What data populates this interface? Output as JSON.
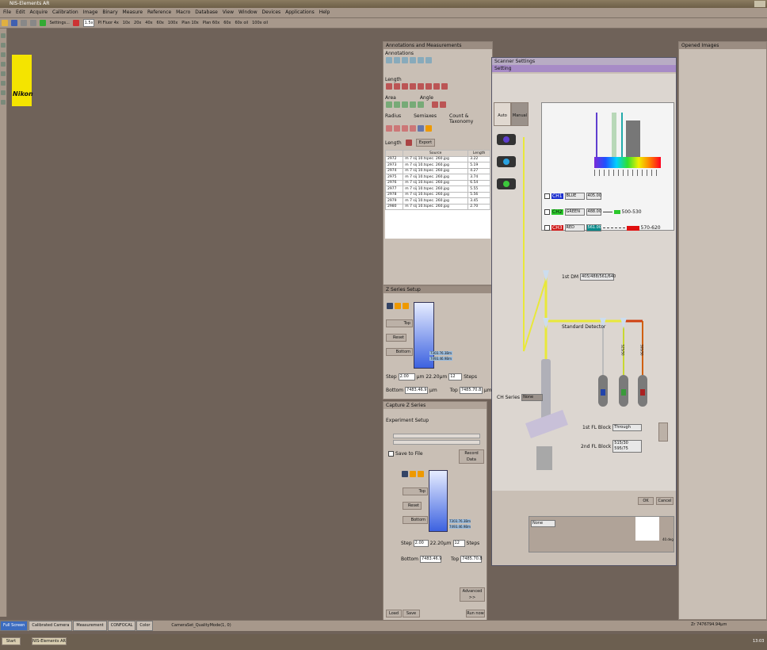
{
  "app": {
    "title": "NIS-Elements AR"
  },
  "menu": [
    "File",
    "Edit",
    "Acquire",
    "Calibration",
    "Image",
    "Binary",
    "Measure",
    "Reference",
    "Macro",
    "Database",
    "View",
    "Window",
    "Devices",
    "Applications",
    "Help"
  ],
  "toolbar": {
    "settings": "Settings...",
    "zoom": "1.5x",
    "objectives": [
      "Pl Fluor 4x",
      "10x",
      "20x",
      "40x",
      "60x",
      "100x",
      "Plan 10x",
      "Plan 60x",
      "60x",
      "60x oil",
      "100x oil"
    ]
  },
  "annotations_panel": {
    "title": "Annotations and Measurements",
    "annotations_label": "Annotations",
    "length_label": "Length",
    "area_label": "Area",
    "angle_label": "Angle",
    "radius_label": "Radius",
    "semiaxes_label": "Semiaxes",
    "count_label": "Count & Taxonomy",
    "list_mode": "Length",
    "export_label": "Export",
    "table_headers": [
      "Source",
      "Length"
    ],
    "rows": [
      {
        "id": "2972",
        "source": "m 7 sij 10.tspec. 260.jpg",
        "value": "3.22"
      },
      {
        "id": "2973",
        "source": "m 7 sij 10.tspec. 260.jpg",
        "value": "5.19"
      },
      {
        "id": "2974",
        "source": "m 7 sij 10.tspec. 260.jpg",
        "value": "4.27"
      },
      {
        "id": "2975",
        "source": "m 7 sij 10.tspec. 260.jpg",
        "value": "3.74"
      },
      {
        "id": "2976",
        "source": "m 7 sij 10.tspec. 260.jpg",
        "value": "6.54"
      },
      {
        "id": "2977",
        "source": "m 7 sij 10.tspec. 260.jpg",
        "value": "5.55"
      },
      {
        "id": "2978",
        "source": "m 7 sij 10.tspec. 260.jpg",
        "value": "5.56"
      },
      {
        "id": "2979",
        "source": "m 7 sij 10.tspec. 260.jpg",
        "value": "3.45"
      },
      {
        "id": "2980",
        "source": "m 7 sij 10.tspec. 260.jpg",
        "value": "2.70"
      }
    ]
  },
  "zseries": {
    "title": "Z Series Setup",
    "top": "Top",
    "reset": "Reset",
    "bottom": "Bottom",
    "range1": "7303.76.3Bm",
    "range2": "7493.46.9Bm",
    "step_label": "Step",
    "step_value": "2.00",
    "range_value": "22.20µm",
    "steps_value": "12",
    "steps_unit": "Steps",
    "bottom_label": "Bottom",
    "bottom_value": "7483.46.9",
    "top_label": "Top",
    "top_value": "7485.70.8",
    "unit": "µm"
  },
  "capture": {
    "title": "Capture Z Series",
    "experiment_setup": "Experiment Setup",
    "save_to_file": "Save to File",
    "record_data": "Record Data",
    "step_value": "2.00",
    "range_value": "22.20µm",
    "steps_value": "12",
    "bottom_value": "7483.46.9",
    "top_value": "7485.70.8",
    "advanced": "Advanced >>",
    "load": "Load",
    "save": "Save",
    "run": "Run now"
  },
  "scanner_dialog": {
    "title": "Scanner Settings",
    "setting_title": "Setting",
    "mode_auto": "Auto",
    "mode_manual": "Manual",
    "channels": [
      {
        "ch": "CH1",
        "name": "BLUE",
        "wl": "405.00",
        "color": "#1b2fcf"
      },
      {
        "ch": "CH2",
        "name": "GREEN",
        "wl": "488.00",
        "color": "#2bc82b"
      },
      {
        "ch": "CH3",
        "name": "RED",
        "wl": "561.00",
        "color": "#cf1b1b"
      }
    ],
    "filter1": "500-530",
    "filter2": "570-620",
    "first_dm_label": "1st DM",
    "first_dm_value": "405/488/561/640",
    "detector": "Standard Detector",
    "em_labels": [
      "525/50",
      "595/50"
    ],
    "ch_series_label": "CH Series",
    "ch_series_value": "None",
    "first_fl_label": "1st FL Block",
    "first_fl_value": "Through",
    "second_fl_label": "2nd FL Block",
    "second_fl_value": "515/30 595/75",
    "ok": "OK",
    "cancel": "Cancel",
    "lower_select": "None",
    "lower_label": "40.deg"
  },
  "opened_images": {
    "title": "Opened Images"
  },
  "tabs": [
    "Full Screen",
    "Calibrated Camera",
    "Measurement",
    "CONFOCAL",
    "Color"
  ],
  "status": {
    "camera": "CameraSet_QualityMode(1, 0)",
    "right": "Zr 7476794.94µm"
  },
  "taskbar": {
    "start": "Start",
    "task": "NIS-Elements AR",
    "clock": "13:03"
  }
}
